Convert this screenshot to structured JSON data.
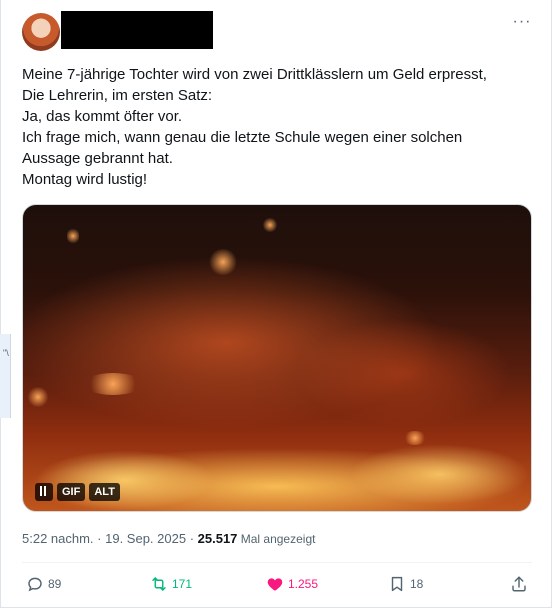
{
  "header": {
    "more_label": "···"
  },
  "tweet": {
    "lines": [
      "Meine 7-jährige Tochter wird von zwei Drittklässlern um Geld erpresst,",
      "Die Lehrerin, im ersten Satz:",
      "Ja, das kommt öfter vor.",
      "Ich frage mich, wann genau die letzte Schule wegen einer solchen",
      "Aussage gebrannt hat.",
      "Montag wird lustig!"
    ]
  },
  "media": {
    "gif_label": "GIF",
    "alt_label": "ALT",
    "pause_icon": "pause-icon"
  },
  "meta": {
    "time": "5:22 nachm.",
    "sep1": " · ",
    "date": "19. Sep. 2025",
    "sep2": " · ",
    "views": "25.517",
    "views_label": " Mal angezeigt"
  },
  "actions": {
    "reply_count": "89",
    "retweet_count": "171",
    "like_count": "1.255",
    "bookmark_count": "18"
  },
  "left_strip_text": "\"\\",
  "colors": {
    "retweet": "#00ba7c",
    "like": "#f91880",
    "muted": "#536471"
  }
}
